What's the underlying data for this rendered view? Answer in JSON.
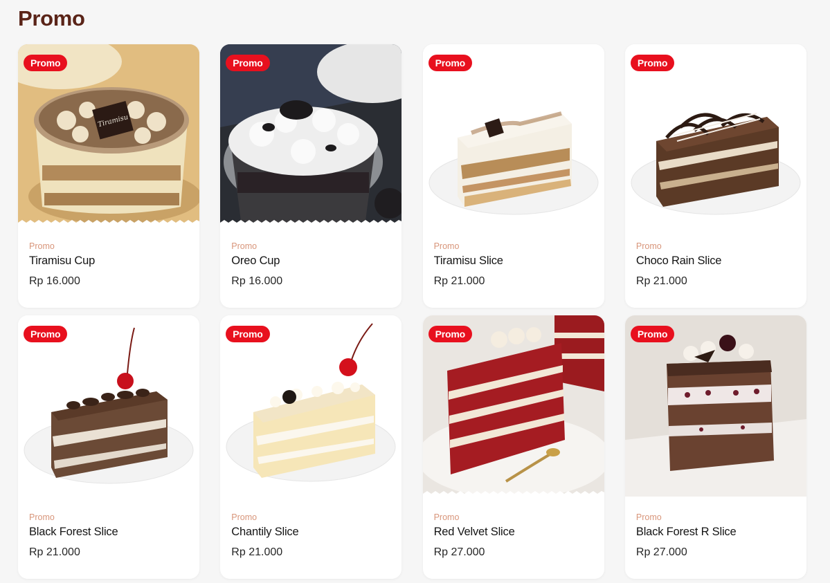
{
  "section": {
    "title": "Promo"
  },
  "colors": {
    "badge": "#e8101e",
    "category": "#d8957a",
    "title": "#5a2418"
  },
  "products": [
    {
      "badge": "Promo",
      "category": "Promo",
      "name": "Tiramisu Cup",
      "price": "Rp 16.000",
      "image": "tiramisu-cup"
    },
    {
      "badge": "Promo",
      "category": "Promo",
      "name": "Oreo Cup",
      "price": "Rp 16.000",
      "image": "oreo-cup"
    },
    {
      "badge": "Promo",
      "category": "Promo",
      "name": "Tiramisu Slice",
      "price": "Rp 21.000",
      "image": "tiramisu-slice"
    },
    {
      "badge": "Promo",
      "category": "Promo",
      "name": "Choco Rain Slice",
      "price": "Rp 21.000",
      "image": "choco-rain-slice"
    },
    {
      "badge": "Promo",
      "category": "Promo",
      "name": "Black Forest Slice",
      "price": "Rp 21.000",
      "image": "black-forest-slice"
    },
    {
      "badge": "Promo",
      "category": "Promo",
      "name": "Chantily Slice",
      "price": "Rp 21.000",
      "image": "chantily-slice"
    },
    {
      "badge": "Promo",
      "category": "Promo",
      "name": "Red Velvet Slice",
      "price": "Rp 27.000",
      "image": "red-velvet-slice"
    },
    {
      "badge": "Promo",
      "category": "Promo",
      "name": "Black Forest R Slice",
      "price": "Rp 27.000",
      "image": "black-forest-r-slice"
    }
  ]
}
